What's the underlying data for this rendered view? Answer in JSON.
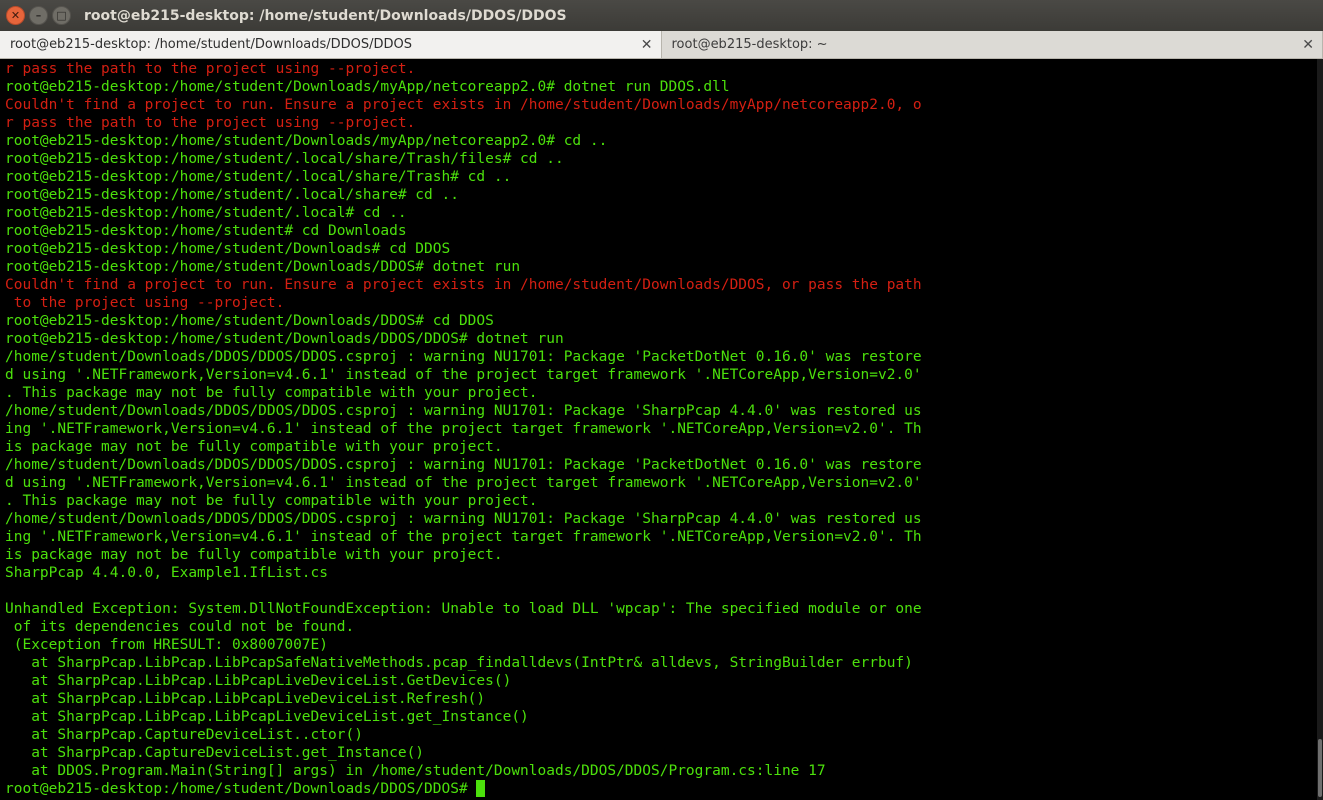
{
  "window": {
    "title": "root@eb215-desktop: /home/student/Downloads/DDOS/DDOS",
    "close_glyph": "✕",
    "min_glyph": "–",
    "max_glyph": "□"
  },
  "tabs": [
    {
      "label": "root@eb215-desktop: /home/student/Downloads/DDOS/DDOS",
      "close": "✕"
    },
    {
      "label": "root@eb215-desktop: ~",
      "close": "✕"
    }
  ],
  "colors": {
    "prompt_green": "#4ce00c",
    "error_red": "#d41f12",
    "background": "#000000"
  },
  "terminal": {
    "lines": [
      {
        "c": "r",
        "t": "r pass the path to the project using --project."
      },
      {
        "c": "g",
        "t": "root@eb215-desktop:/home/student/Downloads/myApp/netcoreapp2.0# dotnet run DDOS.dll"
      },
      {
        "c": "r",
        "t": "Couldn't find a project to run. Ensure a project exists in /home/student/Downloads/myApp/netcoreapp2.0, o"
      },
      {
        "c": "r",
        "t": "r pass the path to the project using --project."
      },
      {
        "c": "g",
        "t": "root@eb215-desktop:/home/student/Downloads/myApp/netcoreapp2.0# cd .."
      },
      {
        "c": "g",
        "t": "root@eb215-desktop:/home/student/.local/share/Trash/files# cd .."
      },
      {
        "c": "g",
        "t": "root@eb215-desktop:/home/student/.local/share/Trash# cd .."
      },
      {
        "c": "g",
        "t": "root@eb215-desktop:/home/student/.local/share# cd .."
      },
      {
        "c": "g",
        "t": "root@eb215-desktop:/home/student/.local# cd .."
      },
      {
        "c": "g",
        "t": "root@eb215-desktop:/home/student# cd Downloads"
      },
      {
        "c": "g",
        "t": "root@eb215-desktop:/home/student/Downloads# cd DDOS"
      },
      {
        "c": "g",
        "t": "root@eb215-desktop:/home/student/Downloads/DDOS# dotnet run"
      },
      {
        "c": "r",
        "t": "Couldn't find a project to run. Ensure a project exists in /home/student/Downloads/DDOS, or pass the path"
      },
      {
        "c": "r",
        "t": " to the project using --project."
      },
      {
        "c": "g",
        "t": "root@eb215-desktop:/home/student/Downloads/DDOS# cd DDOS"
      },
      {
        "c": "g",
        "t": "root@eb215-desktop:/home/student/Downloads/DDOS/DDOS# dotnet run"
      },
      {
        "c": "g",
        "t": "/home/student/Downloads/DDOS/DDOS/DDOS.csproj : warning NU1701: Package 'PacketDotNet 0.16.0' was restore"
      },
      {
        "c": "g",
        "t": "d using '.NETFramework,Version=v4.6.1' instead of the project target framework '.NETCoreApp,Version=v2.0'"
      },
      {
        "c": "g",
        "t": ". This package may not be fully compatible with your project."
      },
      {
        "c": "g",
        "t": "/home/student/Downloads/DDOS/DDOS/DDOS.csproj : warning NU1701: Package 'SharpPcap 4.4.0' was restored us"
      },
      {
        "c": "g",
        "t": "ing '.NETFramework,Version=v4.6.1' instead of the project target framework '.NETCoreApp,Version=v2.0'. Th"
      },
      {
        "c": "g",
        "t": "is package may not be fully compatible with your project."
      },
      {
        "c": "g",
        "t": "/home/student/Downloads/DDOS/DDOS/DDOS.csproj : warning NU1701: Package 'PacketDotNet 0.16.0' was restore"
      },
      {
        "c": "g",
        "t": "d using '.NETFramework,Version=v4.6.1' instead of the project target framework '.NETCoreApp,Version=v2.0'"
      },
      {
        "c": "g",
        "t": ". This package may not be fully compatible with your project."
      },
      {
        "c": "g",
        "t": "/home/student/Downloads/DDOS/DDOS/DDOS.csproj : warning NU1701: Package 'SharpPcap 4.4.0' was restored us"
      },
      {
        "c": "g",
        "t": "ing '.NETFramework,Version=v4.6.1' instead of the project target framework '.NETCoreApp,Version=v2.0'. Th"
      },
      {
        "c": "g",
        "t": "is package may not be fully compatible with your project."
      },
      {
        "c": "g",
        "t": "SharpPcap 4.4.0.0, Example1.IfList.cs"
      },
      {
        "c": "g",
        "t": ""
      },
      {
        "c": "g",
        "t": "Unhandled Exception: System.DllNotFoundException: Unable to load DLL 'wpcap': The specified module or one"
      },
      {
        "c": "g",
        "t": " of its dependencies could not be found."
      },
      {
        "c": "g",
        "t": " (Exception from HRESULT: 0x8007007E)"
      },
      {
        "c": "g",
        "t": "   at SharpPcap.LibPcap.LibPcapSafeNativeMethods.pcap_findalldevs(IntPtr& alldevs, StringBuilder errbuf)"
      },
      {
        "c": "g",
        "t": "   at SharpPcap.LibPcap.LibPcapLiveDeviceList.GetDevices()"
      },
      {
        "c": "g",
        "t": "   at SharpPcap.LibPcap.LibPcapLiveDeviceList.Refresh()"
      },
      {
        "c": "g",
        "t": "   at SharpPcap.LibPcap.LibPcapLiveDeviceList.get_Instance()"
      },
      {
        "c": "g",
        "t": "   at SharpPcap.CaptureDeviceList..ctor()"
      },
      {
        "c": "g",
        "t": "   at SharpPcap.CaptureDeviceList.get_Instance()"
      },
      {
        "c": "g",
        "t": "   at DDOS.Program.Main(String[] args) in /home/student/Downloads/DDOS/DDOS/Program.cs:line 17"
      }
    ],
    "prompt": "root@eb215-desktop:/home/student/Downloads/DDOS/DDOS# "
  }
}
